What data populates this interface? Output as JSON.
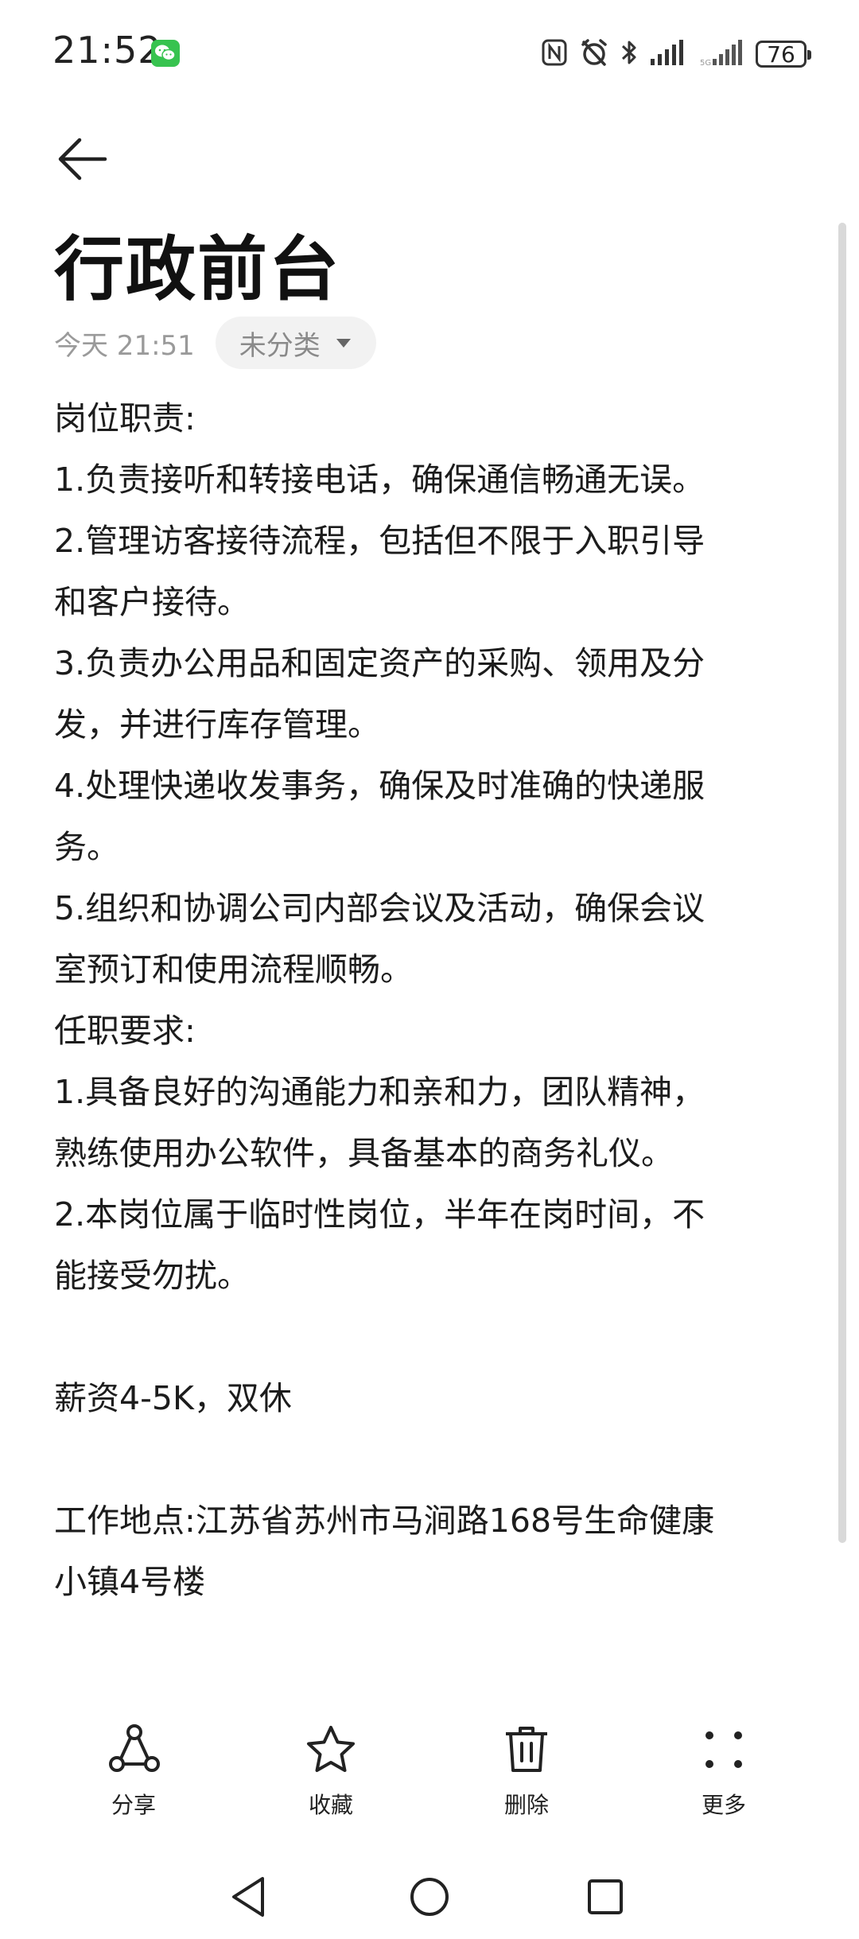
{
  "status_bar": {
    "time": "21:52",
    "battery": "76"
  },
  "note": {
    "title": "行政前台",
    "date": "今天 21:51",
    "category": "未分类",
    "lines": [
      "岗位职责:",
      "1.负责接听和转接电话，确保通信畅通无误。",
      "2.管理访客接待流程，包括但不限于入职引导",
      "和客户接待。",
      "3.负责办公用品和固定资产的采购、领用及分",
      "发，并进行库存管理。",
      "4.处理快递收发事务，确保及时准确的快递服",
      "务。",
      "5.组织和协调公司内部会议及活动，确保会议",
      "室预订和使用流程顺畅。",
      "任职要求:",
      "1.具备良好的沟通能力和亲和力，团队精神，",
      "熟练使用办公软件，具备基本的商务礼仪。",
      "2.本岗位属于临时性岗位，半年在岗时间，不",
      "能接受勿扰。",
      "",
      "薪资4-5K，双休",
      "",
      "工作地点:江苏省苏州市马涧路168号生命健康",
      "小镇4号楼"
    ]
  },
  "toolbar": {
    "share_label": "分享",
    "favorite_label": "收藏",
    "delete_label": "删除",
    "more_label": "更多"
  },
  "icons": {
    "back": "arrow-left-icon",
    "share": "share-icon",
    "favorite": "star-icon",
    "delete": "trash-icon",
    "more": "more-dots-icon"
  }
}
